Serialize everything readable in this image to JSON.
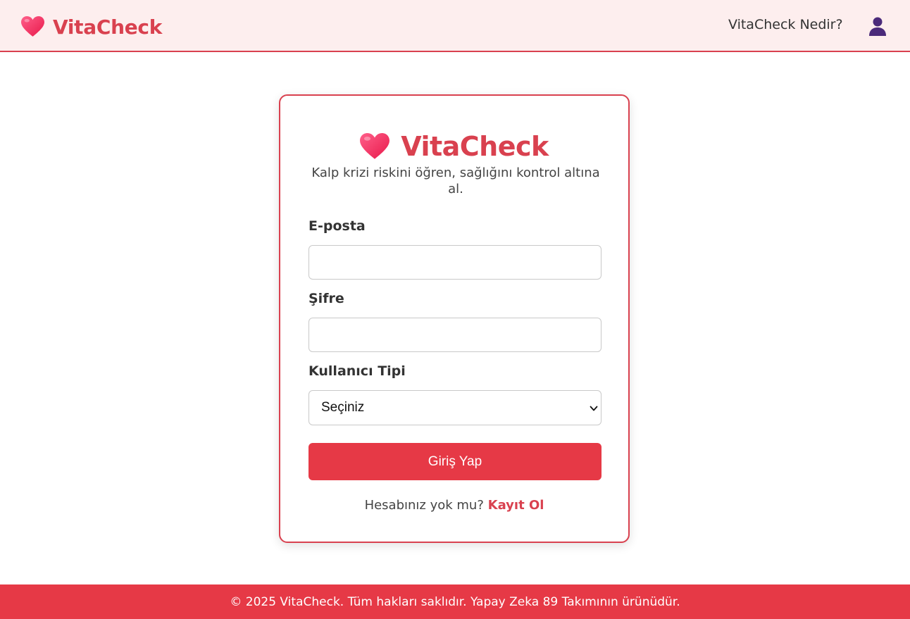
{
  "header": {
    "brand_name": "VitaCheck",
    "brand_icon": "heart-icon",
    "nav_link": "VitaCheck Nedir?",
    "user_icon": "user-icon"
  },
  "login_card": {
    "title": "VitaCheck",
    "subtitle": "Kalp krizi riskini öğren, sağlığını kontrol altına al.",
    "email_label": "E-posta",
    "email_value": "",
    "password_label": "Şifre",
    "password_value": "",
    "user_type_label": "Kullanıcı Tipi",
    "user_type_selected": "Seçiniz",
    "submit_label": "Giriş Yap",
    "signup_prompt": "Hesabınız yok mu?",
    "signup_link": "Kayıt Ol"
  },
  "footer": {
    "text": "© 2025 VitaCheck. Tüm hakları saklıdır. Yapay Zeka 89 Takımının ürünüdür."
  },
  "colors": {
    "accent": "#e63946",
    "brand_text": "#d9414f",
    "header_bg": "#fdeeee",
    "user_icon": "#4b2a7a"
  }
}
